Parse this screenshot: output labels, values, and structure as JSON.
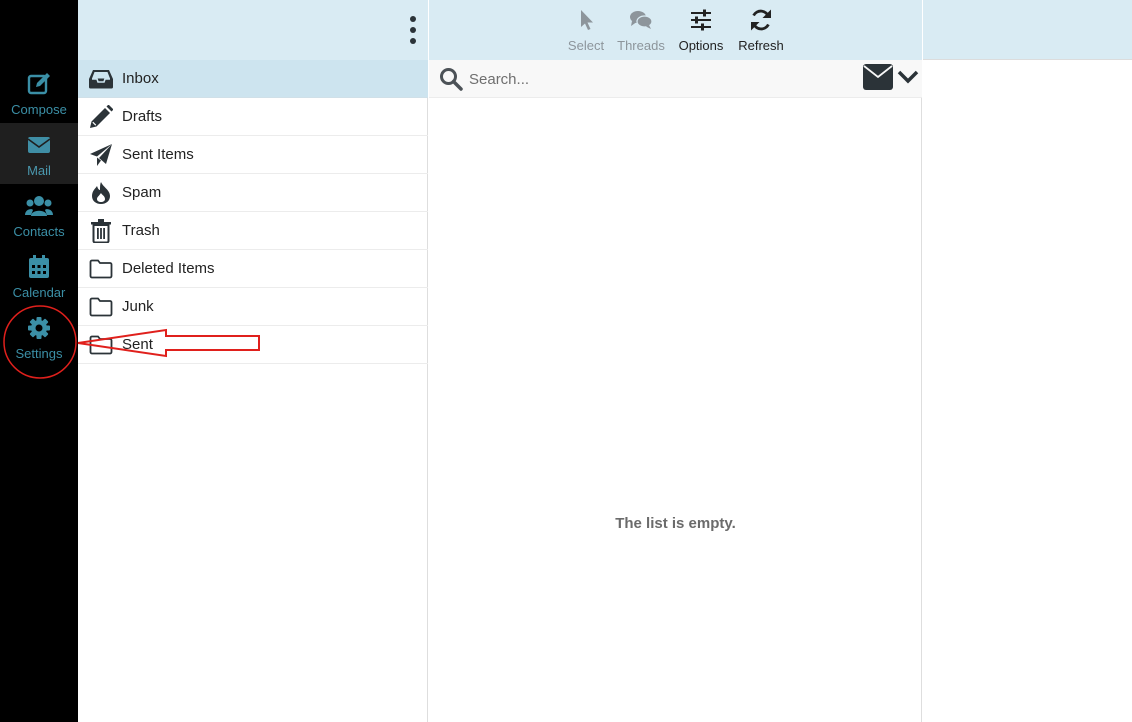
{
  "taskbar": {
    "items": [
      {
        "label": "Compose",
        "icon": "compose-icon"
      },
      {
        "label": "Mail",
        "icon": "envelope-icon",
        "selected": true
      },
      {
        "label": "Contacts",
        "icon": "users-icon"
      },
      {
        "label": "Calendar",
        "icon": "calendar-icon"
      },
      {
        "label": "Settings",
        "icon": "gear-icon"
      }
    ]
  },
  "folders": {
    "items": [
      {
        "label": "Inbox",
        "icon": "inbox-icon",
        "selected": true
      },
      {
        "label": "Drafts",
        "icon": "pencil-icon"
      },
      {
        "label": "Sent Items",
        "icon": "paper-plane-icon"
      },
      {
        "label": "Spam",
        "icon": "fire-icon"
      },
      {
        "label": "Trash",
        "icon": "trash-icon"
      },
      {
        "label": "Deleted Items",
        "icon": "folder-icon"
      },
      {
        "label": "Junk",
        "icon": "folder-icon"
      },
      {
        "label": "Sent",
        "icon": "folder-icon"
      }
    ]
  },
  "toolbar": {
    "select_label": "Select",
    "threads_label": "Threads",
    "options_label": "Options",
    "refresh_label": "Refresh"
  },
  "search": {
    "placeholder": "Search...",
    "value": ""
  },
  "message_list": {
    "empty_text": "The list is empty."
  },
  "colors": {
    "taskbar_bg": "#000000",
    "taskbar_text": "#3b8fa6",
    "header_bg": "#d9ebf3",
    "selected_folder_bg": "#cde4ef",
    "annotation_red": "#e0201c"
  }
}
